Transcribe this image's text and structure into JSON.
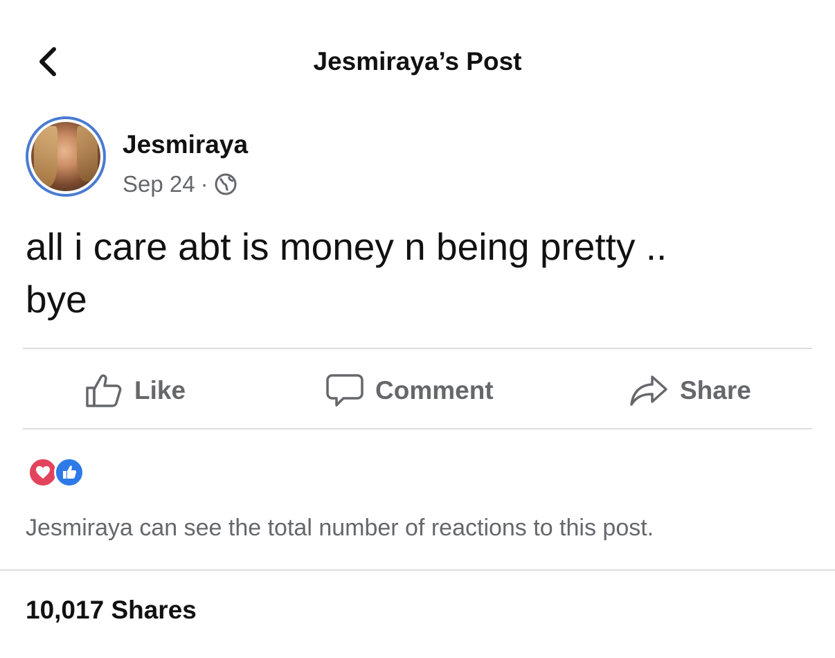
{
  "header": {
    "title": "Jesmiraya’s Post"
  },
  "post": {
    "author": "Jesmiraya",
    "date": "Sep 24",
    "separator": "·",
    "text": "all i care abt is money n being pretty ..\nbye",
    "audience_icon": "globe-icon"
  },
  "actions": {
    "like_label": "Like",
    "comment_label": "Comment",
    "share_label": "Share"
  },
  "reactions": {
    "icons": [
      "love-icon",
      "like-reaction-icon"
    ],
    "colors": {
      "love": "#e2445d",
      "like": "#2d7ae8"
    }
  },
  "footer": {
    "visibility_note": "Jesmiraya can see the total number of reactions to this post.",
    "shares": "10,017 Shares"
  }
}
